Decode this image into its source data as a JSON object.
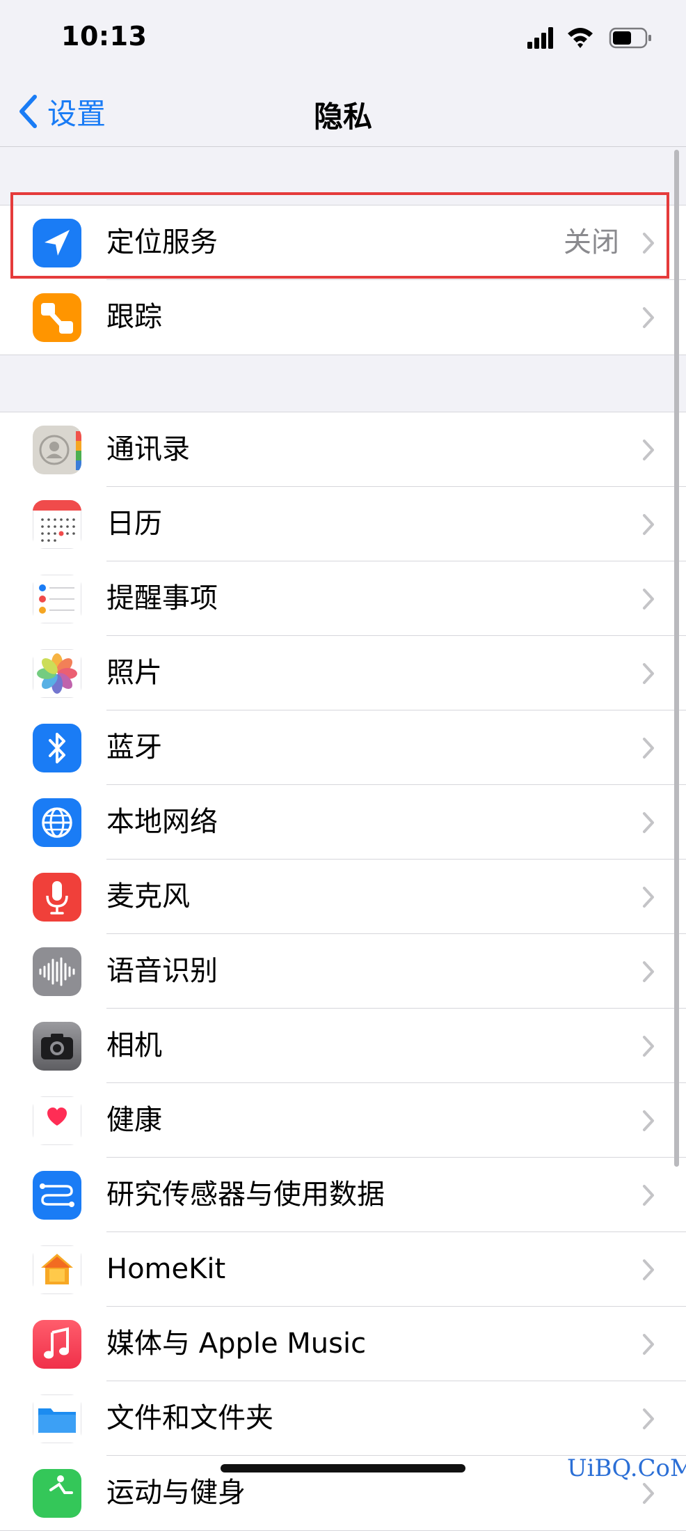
{
  "status_bar": {
    "time": "10:13"
  },
  "nav": {
    "back_label": "设置",
    "title": "隐私"
  },
  "group1": [
    {
      "icon": "location-arrow-icon",
      "label": "定位服务",
      "value": "关闭"
    },
    {
      "icon": "tracking-icon",
      "label": "跟踪"
    }
  ],
  "group2": [
    {
      "icon": "contacts-icon",
      "label": "通讯录"
    },
    {
      "icon": "calendar-icon",
      "label": "日历"
    },
    {
      "icon": "reminders-icon",
      "label": "提醒事项"
    },
    {
      "icon": "photos-icon",
      "label": "照片"
    },
    {
      "icon": "bluetooth-icon",
      "label": "蓝牙"
    },
    {
      "icon": "local-network-icon",
      "label": "本地网络"
    },
    {
      "icon": "microphone-icon",
      "label": "麦克风"
    },
    {
      "icon": "speech-recognition-icon",
      "label": "语音识别"
    },
    {
      "icon": "camera-icon",
      "label": "相机"
    },
    {
      "icon": "health-icon",
      "label": "健康"
    },
    {
      "icon": "research-sensor-icon",
      "label": "研究传感器与使用数据"
    },
    {
      "icon": "homekit-icon",
      "label": "HomeKit"
    },
    {
      "icon": "music-icon",
      "label": "媒体与 Apple Music"
    },
    {
      "icon": "files-folder-icon",
      "label": "文件和文件夹"
    },
    {
      "icon": "motion-fitness-icon",
      "label": "运动与健身"
    }
  ],
  "watermark": "UiBQ.CoM",
  "colors": {
    "accent": "#1A7CF5",
    "highlight": "#E53B3B",
    "background": "#F2F2F7"
  }
}
